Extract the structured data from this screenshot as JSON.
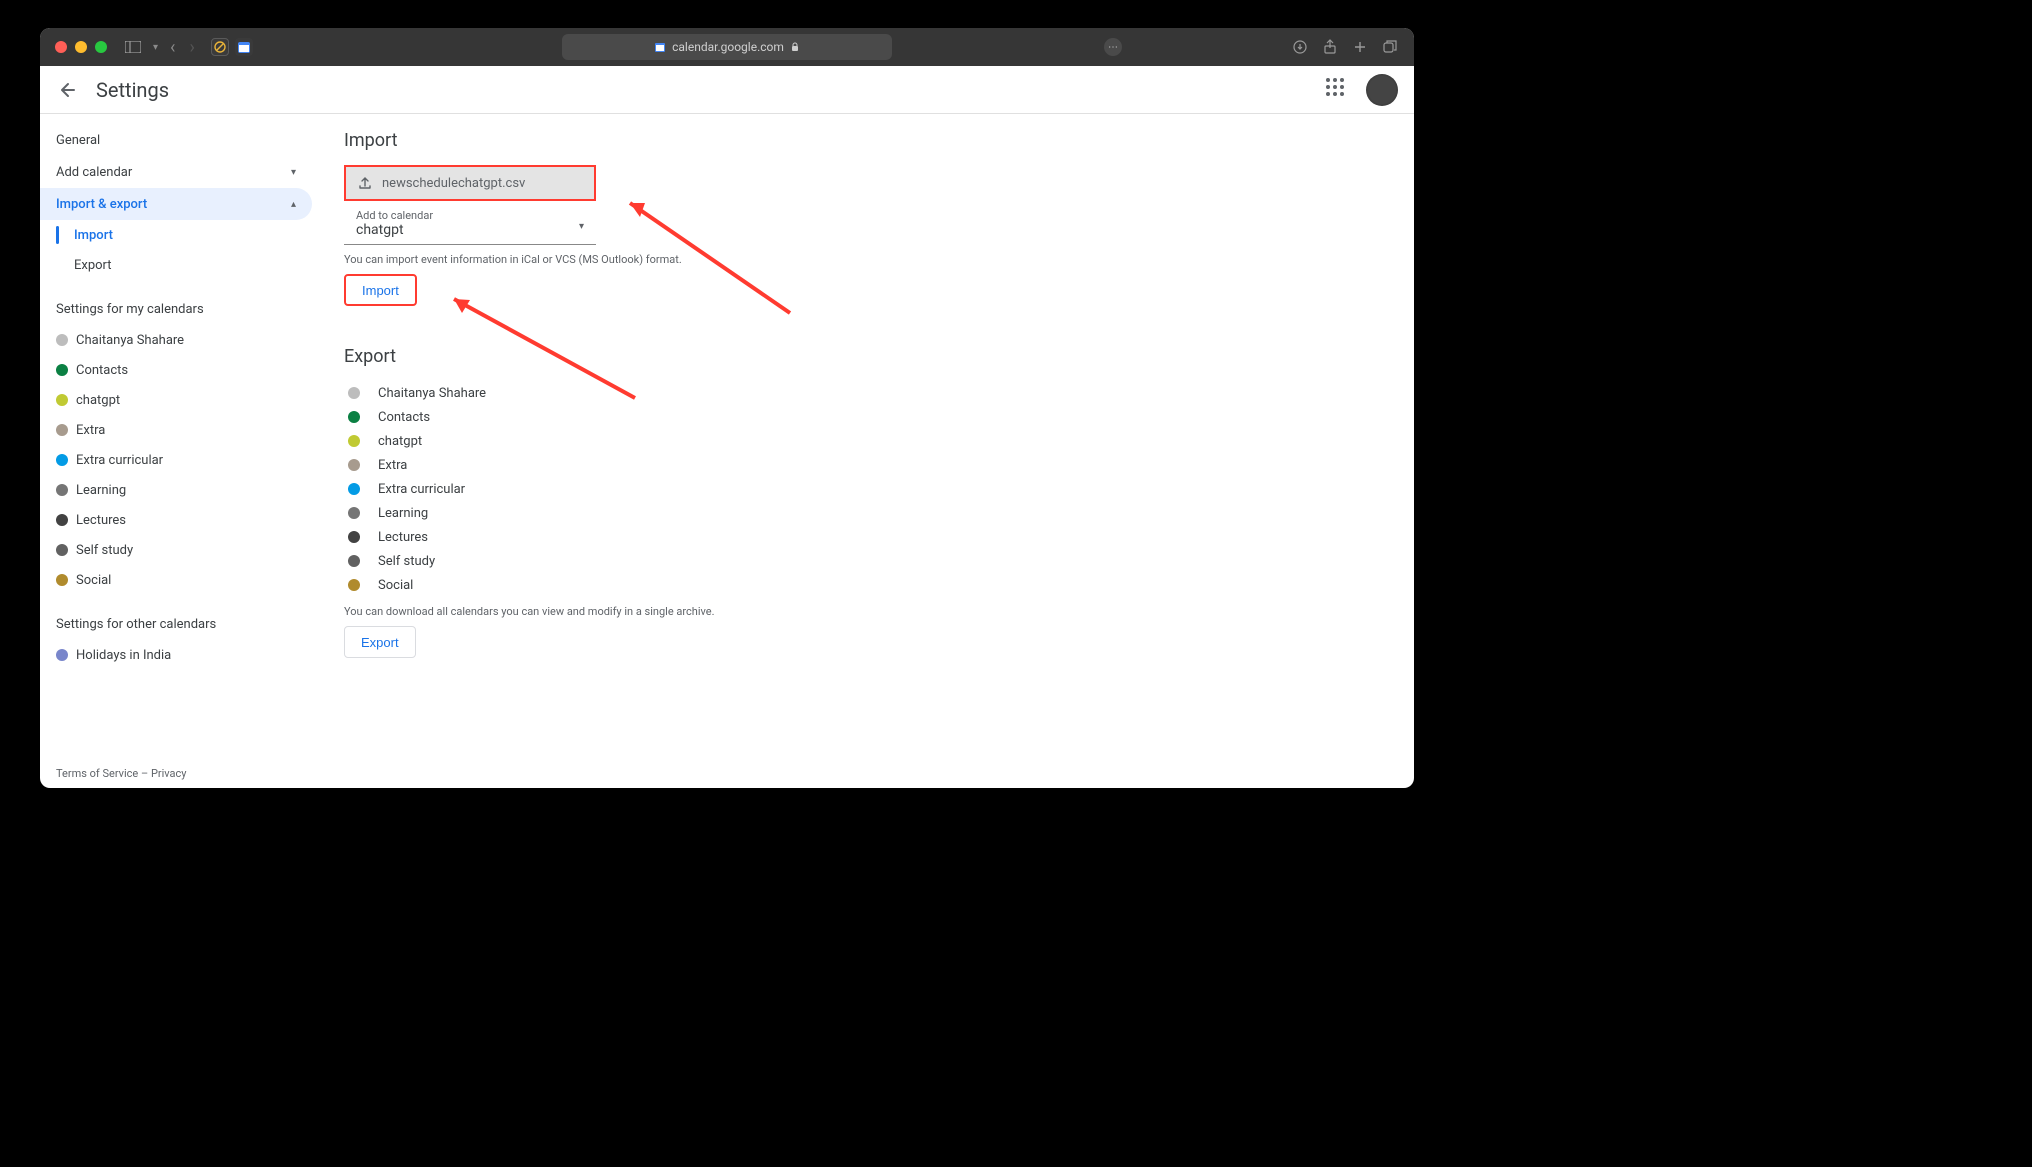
{
  "browser": {
    "url": "calendar.google.com"
  },
  "header": {
    "title": "Settings"
  },
  "sidebar": {
    "general": "General",
    "add_calendar": "Add calendar",
    "import_export": "Import & export",
    "subs": [
      {
        "label": "Import",
        "active": true
      },
      {
        "label": "Export",
        "active": false
      }
    ],
    "my_cal_heading": "Settings for my calendars",
    "my_calendars": [
      {
        "label": "Chaitanya Shahare",
        "color": "#bdbdbd"
      },
      {
        "label": "Contacts",
        "color": "#0b8043"
      },
      {
        "label": "chatgpt",
        "color": "#c0ca33"
      },
      {
        "label": "Extra",
        "color": "#a79b8e"
      },
      {
        "label": "Extra curricular",
        "color": "#039be5"
      },
      {
        "label": "Learning",
        "color": "#757575"
      },
      {
        "label": "Lectures",
        "color": "#424242"
      },
      {
        "label": "Self study",
        "color": "#616161"
      },
      {
        "label": "Social",
        "color": "#b08b2d"
      }
    ],
    "other_cal_heading": "Settings for other calendars",
    "other_calendars": [
      {
        "label": "Holidays in India",
        "color": "#7986cb"
      }
    ]
  },
  "import_section": {
    "title": "Import",
    "file_name": "newschedulechatgpt.csv",
    "select_label": "Add to calendar",
    "select_value": "chatgpt",
    "hint": "You can import event information in iCal or VCS (MS Outlook) format.",
    "button": "Import"
  },
  "export_section": {
    "title": "Export",
    "calendars": [
      {
        "label": "Chaitanya Shahare",
        "color": "#bdbdbd"
      },
      {
        "label": "Contacts",
        "color": "#0b8043"
      },
      {
        "label": "chatgpt",
        "color": "#c0ca33"
      },
      {
        "label": "Extra",
        "color": "#a79b8e"
      },
      {
        "label": "Extra curricular",
        "color": "#039be5"
      },
      {
        "label": "Learning",
        "color": "#757575"
      },
      {
        "label": "Lectures",
        "color": "#424242"
      },
      {
        "label": "Self study",
        "color": "#616161"
      },
      {
        "label": "Social",
        "color": "#b08b2d"
      }
    ],
    "hint": "You can download all calendars you can view and modify in a single archive.",
    "button": "Export"
  },
  "footer": {
    "terms": "Terms of Service",
    "sep": " – ",
    "privacy": "Privacy"
  }
}
